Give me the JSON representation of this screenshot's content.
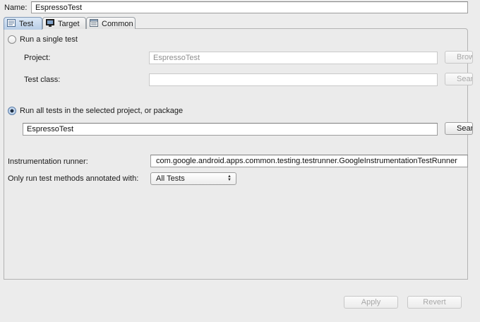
{
  "name": {
    "label": "Name:",
    "value": "EspressoTest"
  },
  "tabs": [
    {
      "label": "Test",
      "icon": "test-tab-icon",
      "active": true
    },
    {
      "label": "Target",
      "icon": "monitor-icon",
      "active": false
    },
    {
      "label": "Common",
      "icon": "common-tab-icon",
      "active": false
    }
  ],
  "single_test": {
    "radio_label": "Run a single test",
    "project_label": "Project:",
    "project_value": "EspressoTest",
    "browse_label": "Browse...",
    "class_label": "Test class:",
    "class_value": "",
    "search_label": "Search..."
  },
  "all_tests": {
    "radio_label": "Run all tests in the selected project, or package",
    "value": "EspressoTest",
    "search_label": "Search..."
  },
  "runner": {
    "label": "Instrumentation runner:",
    "value": "com.google.android.apps.common.testing.testrunner.GoogleInstrumentationTestRunner"
  },
  "annotation": {
    "label": "Only run test methods annotated with:",
    "selected": "All Tests"
  },
  "footer": {
    "apply_label": "Apply",
    "revert_label": "Revert"
  }
}
